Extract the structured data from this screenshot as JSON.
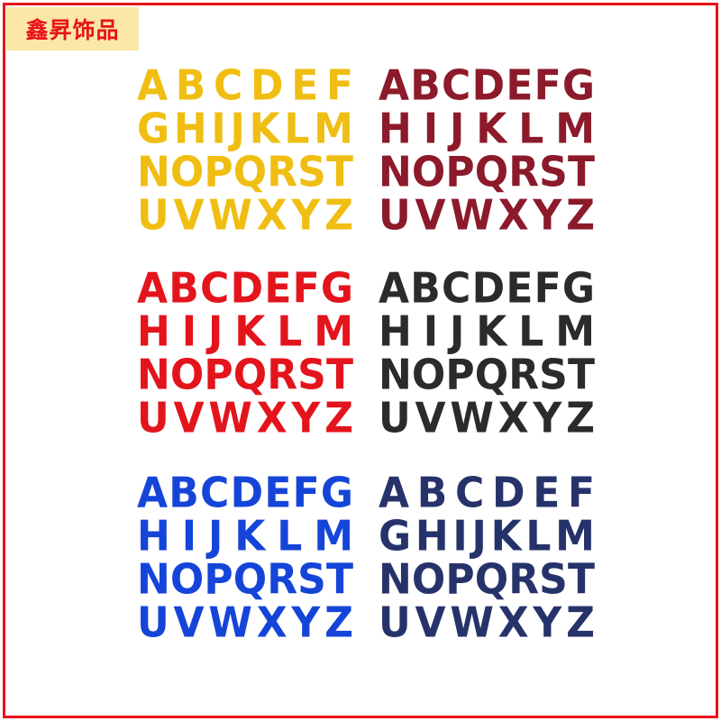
{
  "brand": {
    "text": "鑫昇饰品",
    "text_color": "#e8131b",
    "bg_color": "#fbe7a6"
  },
  "frame_color": "#e8131b",
  "blocks": [
    {
      "id": "yellow",
      "color": "#f0be12",
      "rows": [
        "ABCDEF",
        "GHIJKLM",
        "NOPQRST",
        "UVWXYZ"
      ]
    },
    {
      "id": "maroon",
      "color": "#8c1a2a",
      "rows": [
        "ABCDEFG",
        "HIJKLM",
        "NOPQRST",
        "UVWXYZ"
      ]
    },
    {
      "id": "red",
      "color": "#e3141c",
      "rows": [
        "ABCDEFG",
        "HIJKLM",
        "NOPQRST",
        "UVWXYZ"
      ]
    },
    {
      "id": "black",
      "color": "#2b2b2b",
      "rows": [
        "ABCDEFG",
        "HIJKLM",
        "NOPQRST",
        "UVWXYZ"
      ]
    },
    {
      "id": "blue",
      "color": "#1545d8",
      "rows": [
        "ABCDEFG",
        "HIJKLM",
        "NOPQRST",
        "UVWXYZ"
      ]
    },
    {
      "id": "navy",
      "color": "#26336b",
      "rows": [
        "ABCDEF",
        "GHIJKLM",
        "NOPQRST",
        "UVWXYZ"
      ]
    }
  ]
}
